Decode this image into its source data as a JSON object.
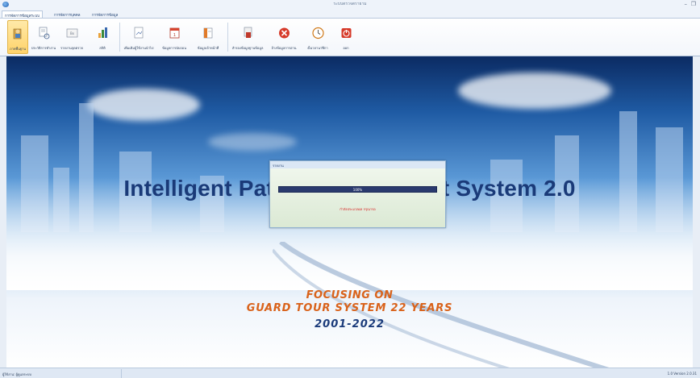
{
  "window": {
    "title": "ระบบตรวจตรายาม",
    "minimize_glyph": "–",
    "restore_glyph": "❐"
  },
  "tabs": [
    {
      "label": "การจัดการข้อมูลระบบ",
      "active": true
    },
    {
      "label": "การจัดการบุคคล",
      "active": false
    },
    {
      "label": "การจัดการข้อมูล",
      "active": false
    }
  ],
  "ribbon": {
    "buttons": [
      {
        "label": "ภาพพื้นฐาน",
        "icon": "base-image-icon",
        "selected": true
      },
      {
        "label": "ประวัติการทำงาน",
        "icon": "history-icon",
        "selected": false
      },
      {
        "label": "รายงานจุดตรวจ",
        "icon": "checkpoint-report-icon",
        "selected": false
      },
      {
        "label": "สถิติ",
        "icon": "statistics-icon",
        "selected": false
      },
      {
        "label": "เพิ่มเติมผู้ใช้งานนำไป",
        "icon": "add-user-icon",
        "selected": false
      },
      {
        "label": "ข้อมูลการนับถอน",
        "icon": "calendar-icon",
        "selected": false
      },
      {
        "label": "ข้อมูลเจ้าหน้าที่",
        "icon": "staff-info-icon",
        "selected": false
      },
      {
        "label": "สำรองข้อมูลฐานข้อมูล",
        "icon": "backup-icon",
        "selected": false
      },
      {
        "label": "ล้างข้อมูลการอ่าน",
        "icon": "clear-data-icon",
        "selected": false
      },
      {
        "label": "ตั้งเวลานาฬิกา",
        "icon": "clock-icon",
        "selected": false
      },
      {
        "label": "ออก",
        "icon": "exit-icon",
        "selected": false
      }
    ]
  },
  "main": {
    "title": "Intelligent Patrol Management System 2.0",
    "slogan_line1": "FOCUSING ON",
    "slogan_line2": "GUARD TOUR SYSTEM 22 YEARS",
    "slogan_line3": "2001-2022"
  },
  "dialog": {
    "title": "รายงาน",
    "progress_text": "100%",
    "progress": 1.0,
    "message": "กำลังประมวลผล กรุณารอ"
  },
  "statusbar": {
    "left": "ผู้ใช้งาน: ผู้ดูแลระบบ",
    "right": "1.0 Version 2.0.31"
  },
  "colors": {
    "accent": "#1a3a78",
    "slogan_orange": "#d9621a",
    "progress_bar": "#2a3a6e"
  }
}
